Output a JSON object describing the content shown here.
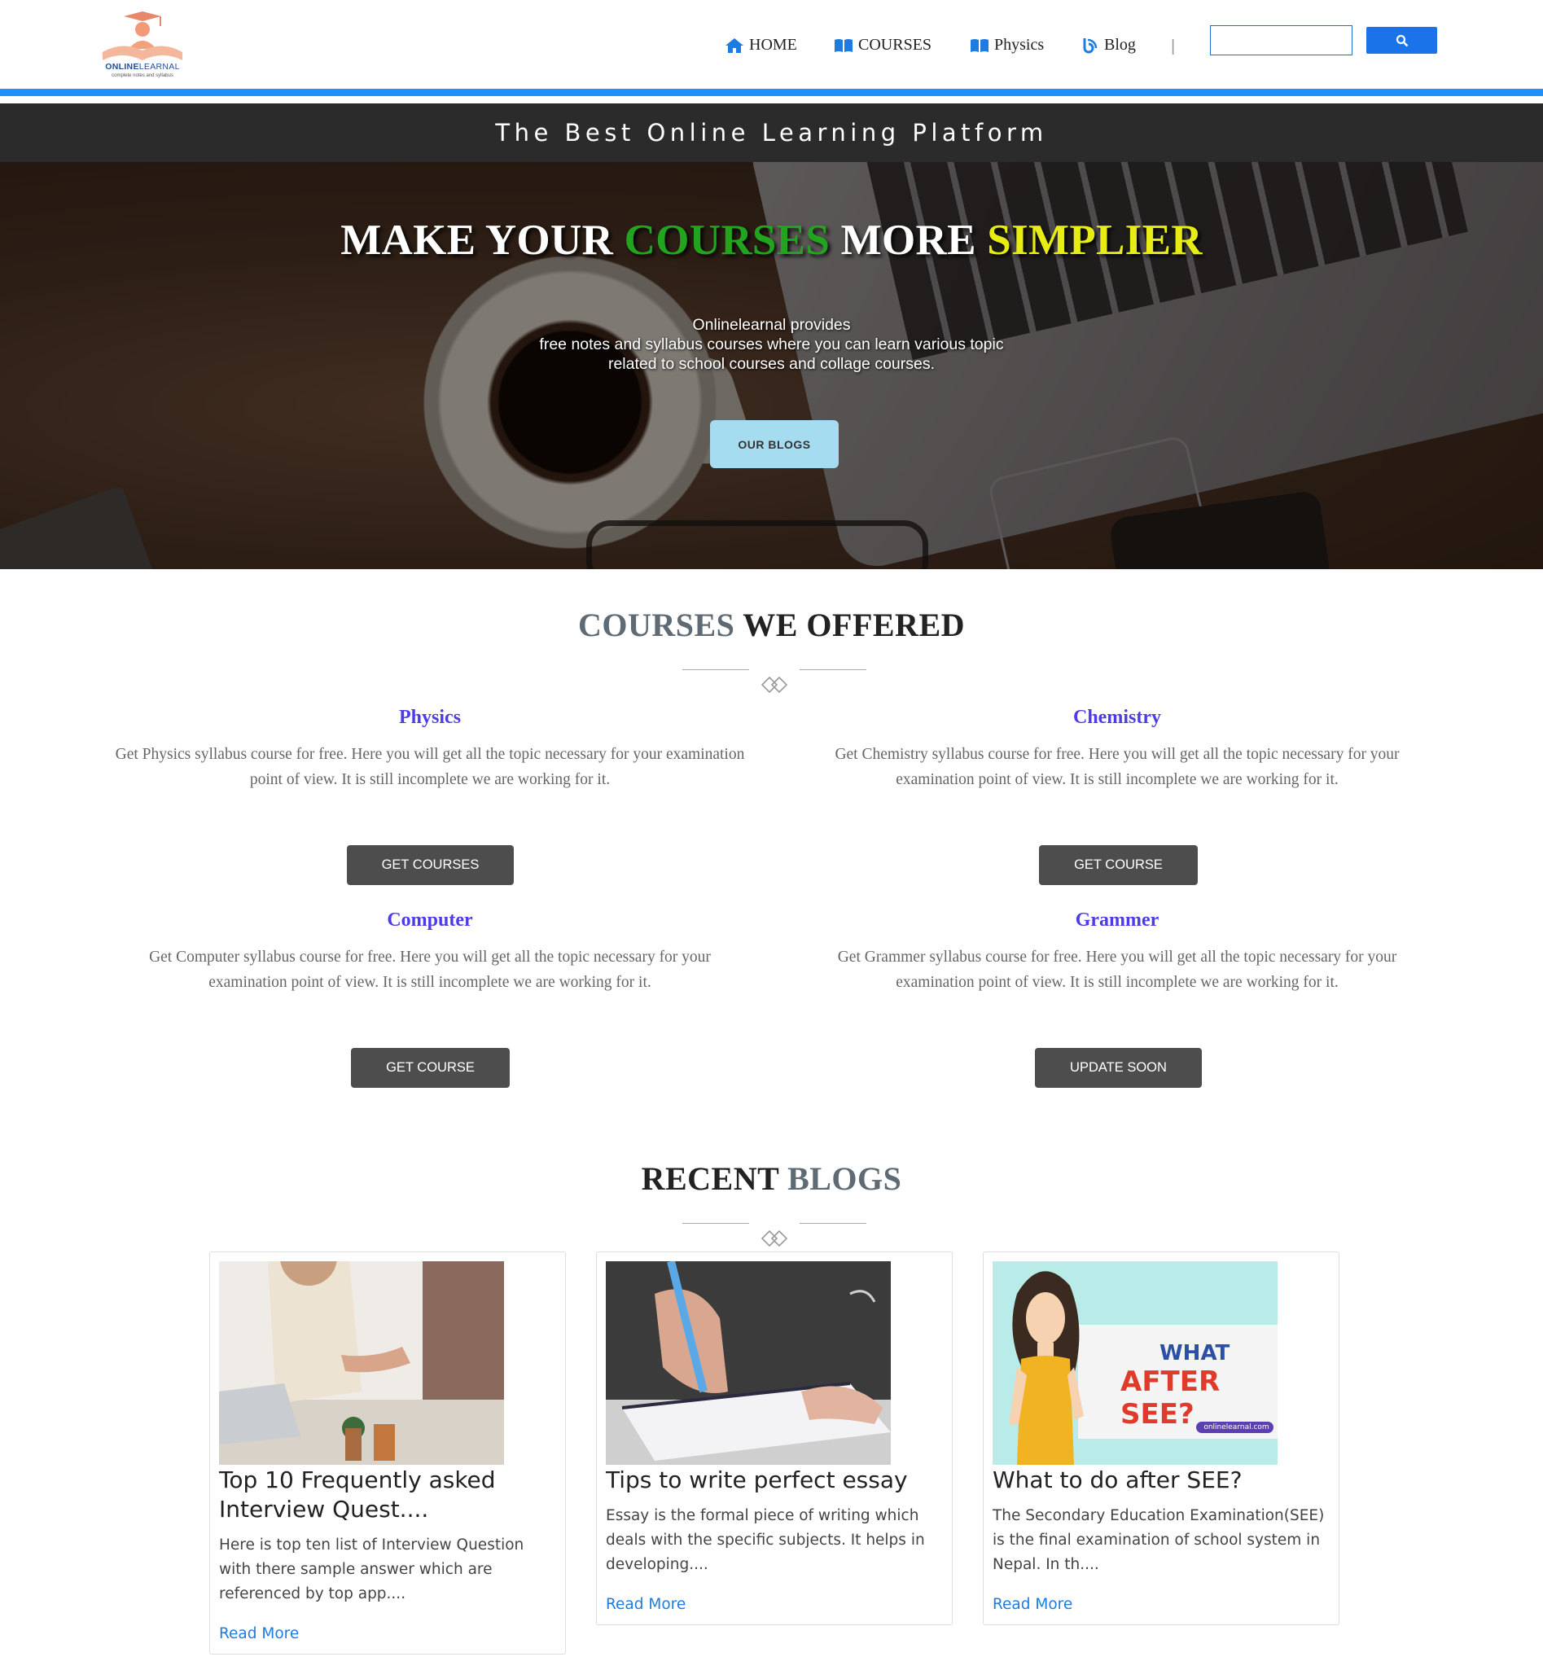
{
  "brand": {
    "name_bold": "ONLINE",
    "name_light": "LEARNAL",
    "tagline": "complete notes and syllabus"
  },
  "nav": {
    "items": [
      {
        "label": "HOME",
        "icon": "home-icon"
      },
      {
        "label": "COURSES",
        "icon": "book-icon"
      },
      {
        "label": "Physics",
        "icon": "book-icon"
      },
      {
        "label": "Blog",
        "icon": "blog-icon"
      }
    ],
    "separator": "|",
    "search_placeholder": ""
  },
  "tagline": "The Best Online Learning Platform",
  "hero": {
    "title_parts": [
      "MAKE YOUR ",
      "COURSES",
      " MORE ",
      "SIMPLIER"
    ],
    "text_lines": [
      "Onlinelearnal provides",
      "free notes and syllabus courses where you can learn various topic",
      "related to school courses and collage courses."
    ],
    "button": "OUR BLOGS"
  },
  "courses_section": {
    "title_muted": "COURSES",
    "title_dark": " WE OFFERED",
    "items": [
      {
        "title": "Physics",
        "description": "Get Physics syllabus course for free. Here you will get all the topic necessary for your examination point of view. It is still incomplete we are working for it.",
        "button": "GET COURSES"
      },
      {
        "title": "Chemistry",
        "description": "Get Chemistry syllabus course for free. Here you will get all the topic necessary for your examination point of view. It is still incomplete we are working for it.",
        "button": "GET COURSE"
      },
      {
        "title": "Computer",
        "description": "Get Computer syllabus course for free. Here you will get all the topic necessary for your examination point of view. It is still incomplete we are working for it.",
        "button": "GET COURSE"
      },
      {
        "title": "Grammer",
        "description": "Get Grammer syllabus course for free. Here you will get all the topic necessary for your examination point of view. It is still incomplete we are working for it.",
        "button": "UPDATE SOON"
      }
    ]
  },
  "blogs_section": {
    "title_dark": "RECENT",
    "title_muted": " BLOGS",
    "cards": [
      {
        "title": "Top 10 Frequently asked Interview Quest....",
        "excerpt": "Here is top ten list of Interview Question with there sample answer which are referenced by top app....",
        "link": "Read More"
      },
      {
        "title": "Tips to write perfect essay",
        "excerpt": "Essay is the formal piece of writing which deals with the specific subjects. It helps in developing....",
        "link": "Read More"
      },
      {
        "title": "What to do after SEE?",
        "excerpt": "The Secondary Education Examination(SEE) is the final examination of school system in Nepal. In th....",
        "link": "Read More"
      }
    ],
    "see_image": {
      "line1": "WHAT",
      "line2": "AFTER SEE?",
      "badge": "onlinelearnal.com"
    }
  },
  "colors": {
    "accent": "#1e90ff",
    "course_title": "#4b3be8",
    "hero_green": "#22a51e",
    "hero_yellow": "#e6ec14",
    "button_dark": "#4d4d4d",
    "link": "#1e7be0"
  }
}
